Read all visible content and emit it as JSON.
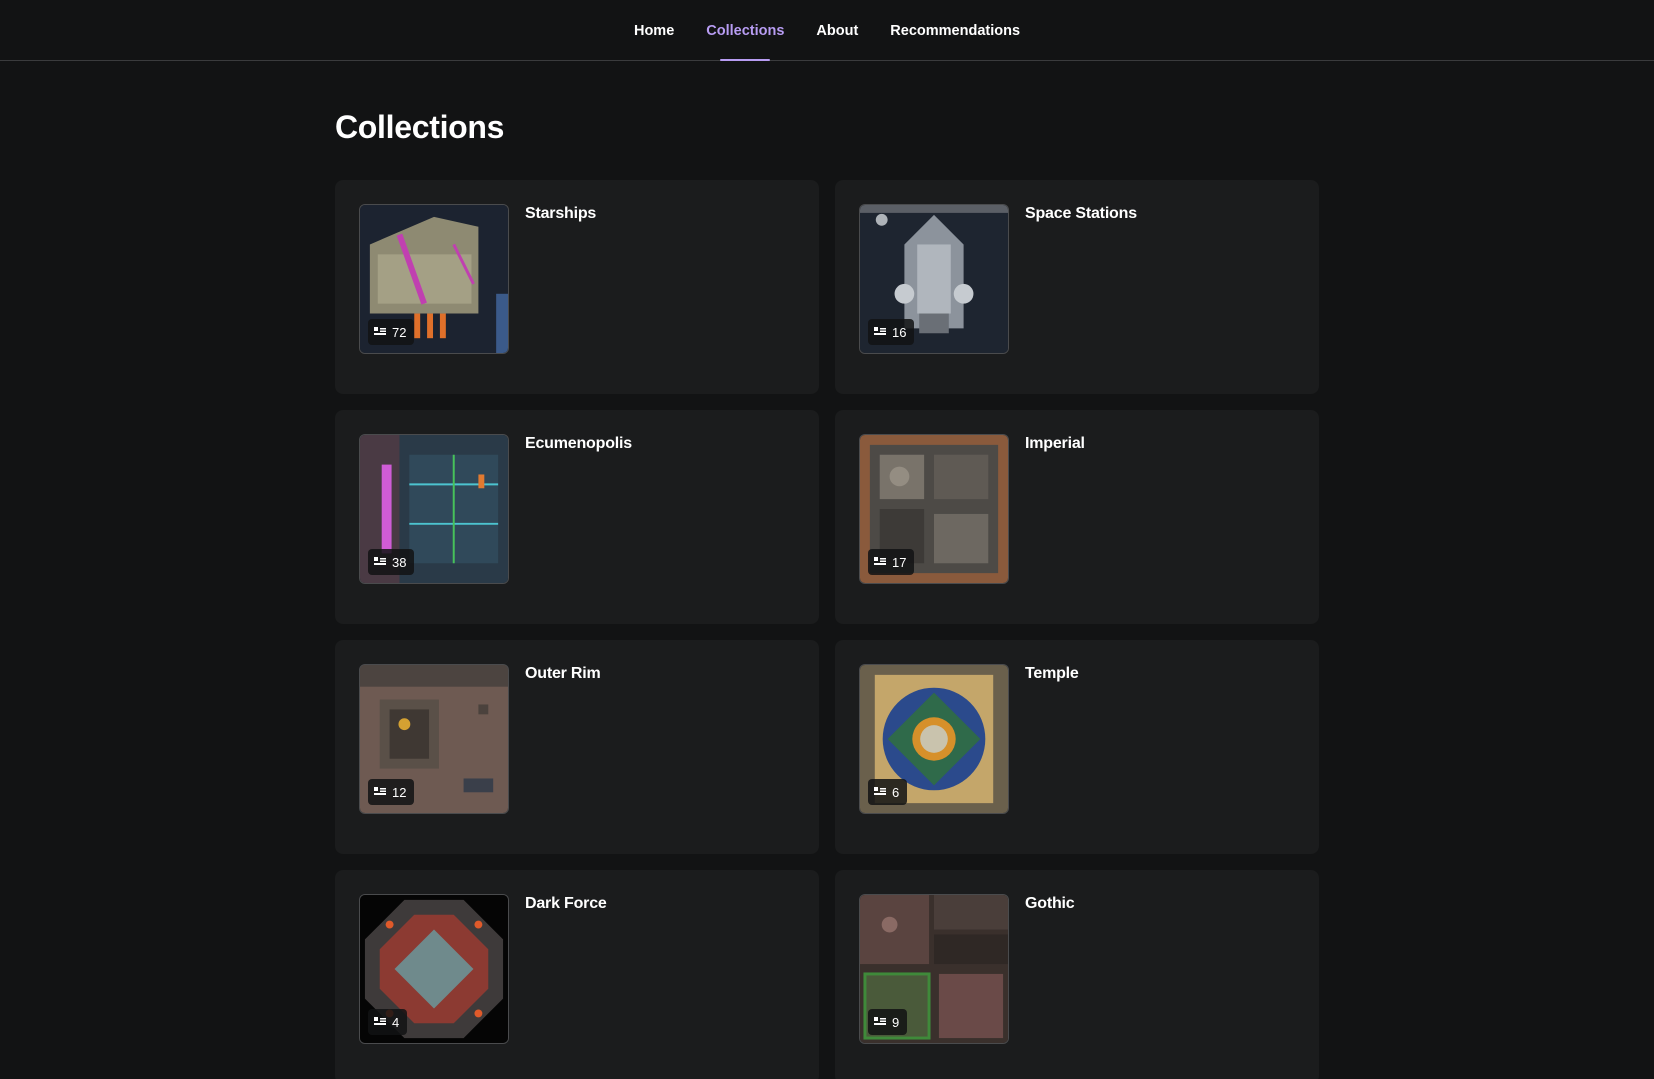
{
  "nav": {
    "items": [
      {
        "label": "Home",
        "active": false
      },
      {
        "label": "Collections",
        "active": true
      },
      {
        "label": "About",
        "active": false
      },
      {
        "label": "Recommendations",
        "active": false
      }
    ],
    "accent_color": "#b79cf2"
  },
  "page": {
    "title": "Collections"
  },
  "collections": [
    {
      "title": "Starships",
      "count": "72",
      "thumb_style": "starship"
    },
    {
      "title": "Space Stations",
      "count": "16",
      "thumb_style": "station"
    },
    {
      "title": "Ecumenopolis",
      "count": "38",
      "thumb_style": "city"
    },
    {
      "title": "Imperial",
      "count": "17",
      "thumb_style": "imperial"
    },
    {
      "title": "Outer Rim",
      "count": "12",
      "thumb_style": "outerrim"
    },
    {
      "title": "Temple",
      "count": "6",
      "thumb_style": "temple"
    },
    {
      "title": "Dark Force",
      "count": "4",
      "thumb_style": "darkforce"
    },
    {
      "title": "Gothic",
      "count": "9",
      "thumb_style": "gothic"
    }
  ],
  "icons": {
    "count_badge": "map-stack-icon"
  }
}
